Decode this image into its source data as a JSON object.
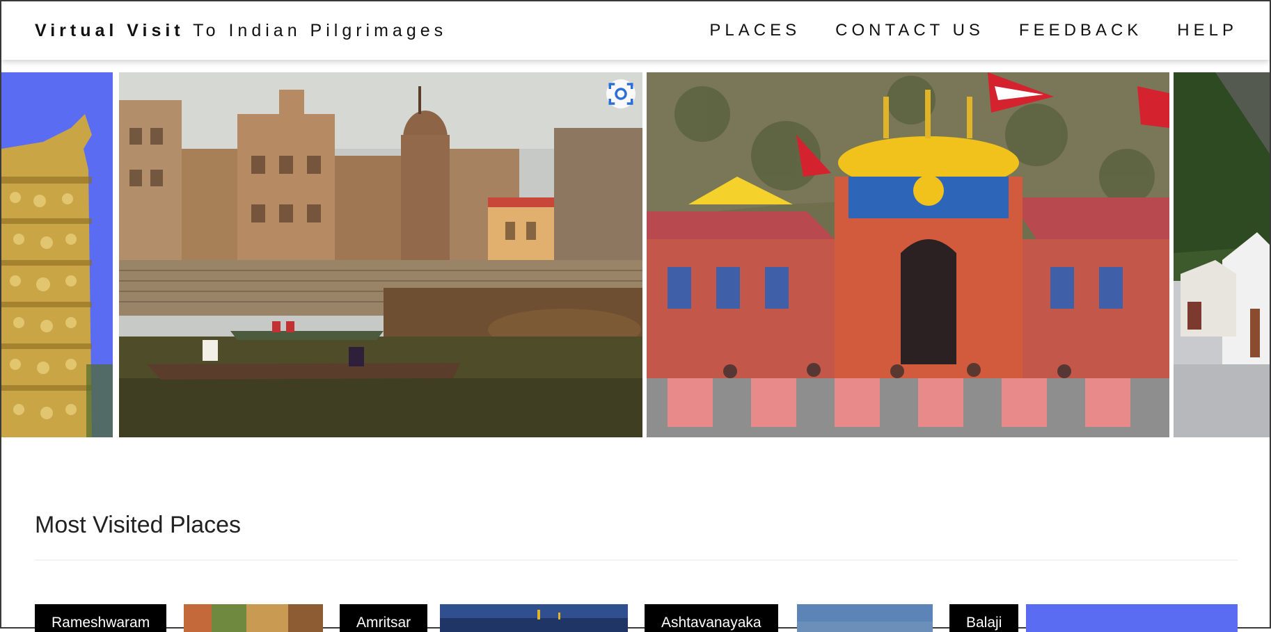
{
  "navbar": {
    "brand_bold": "Virtual Visit",
    "brand_rest": " To Indian Pilgrimages",
    "links": [
      {
        "label": "PLACES"
      },
      {
        "label": "CONTACT US"
      },
      {
        "label": "FEEDBACK"
      },
      {
        "label": "HELP"
      }
    ]
  },
  "carousel": {
    "slides": [
      {
        "subject": "golden temple tower"
      },
      {
        "subject": "river ghats with boats"
      },
      {
        "subject": "painted temple facade with flags"
      },
      {
        "subject": "white temple in mountains"
      }
    ],
    "visual_search_icon": "lens-icon"
  },
  "section": {
    "title": "Most Visited Places"
  },
  "places": [
    {
      "name": "Rameshwaram"
    },
    {
      "name": "Amritsar"
    },
    {
      "name": "Ashtavanayaka"
    },
    {
      "name": "Balaji"
    }
  ],
  "colors": {
    "label_bg": "#000000",
    "label_text": "#ffffff",
    "accent_blue": "#5a6cf2",
    "flag_red": "#d4232f"
  }
}
